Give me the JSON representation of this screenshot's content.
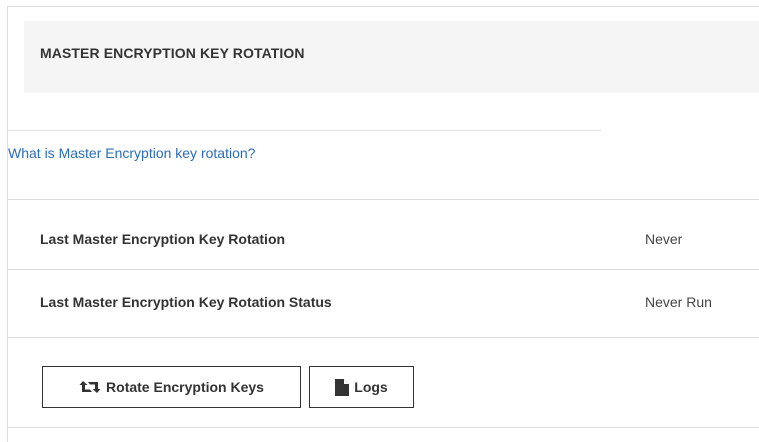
{
  "panel": {
    "title": "MASTER ENCRYPTION KEY ROTATION",
    "help_link": "What is Master Encryption key rotation?"
  },
  "rows": [
    {
      "label": "Last Master Encryption Key Rotation",
      "value": "Never"
    },
    {
      "label": "Last Master Encryption Key Rotation Status",
      "value": "Never Run"
    }
  ],
  "buttons": {
    "rotate_label": "Rotate Encryption Keys",
    "rotate_icon": "retweet-icon",
    "logs_label": "Logs",
    "logs_icon": "file-icon"
  },
  "colors": {
    "link": "#2a6eb5",
    "header_bg": "#f5f5f5"
  }
}
